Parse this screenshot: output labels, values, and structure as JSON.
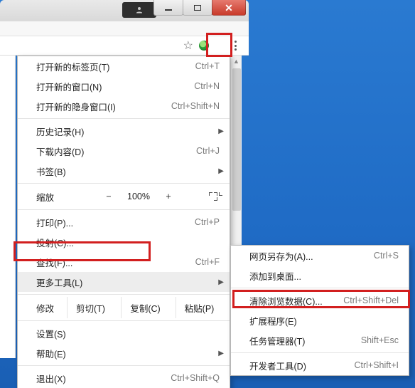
{
  "window": {
    "min": "",
    "max": "",
    "close": "✕"
  },
  "menu1": {
    "newtab": {
      "label": "打开新的标签页(T)",
      "shortcut": "Ctrl+T"
    },
    "newwin": {
      "label": "打开新的窗口(N)",
      "shortcut": "Ctrl+N"
    },
    "incognito": {
      "label": "打开新的隐身窗口(I)",
      "shortcut": "Ctrl+Shift+N"
    },
    "history": {
      "label": "历史记录(H)"
    },
    "downloads": {
      "label": "下载内容(D)",
      "shortcut": "Ctrl+J"
    },
    "bookmarks": {
      "label": "书签(B)"
    },
    "zoom": {
      "label": "缩放",
      "minus": "−",
      "pct": "100%",
      "plus": "+"
    },
    "print": {
      "label": "打印(P)...",
      "shortcut": "Ctrl+P"
    },
    "cast": {
      "label": "投射(C)..."
    },
    "find": {
      "label": "查找(F)...",
      "shortcut": "Ctrl+F"
    },
    "moretools": {
      "label": "更多工具(L)"
    },
    "edit": {
      "label": "修改",
      "cut": "剪切(T)",
      "copy": "复制(C)",
      "paste": "粘贴(P)"
    },
    "settings": {
      "label": "设置(S)"
    },
    "help": {
      "label": "帮助(E)"
    },
    "exit": {
      "label": "退出(X)",
      "shortcut": "Ctrl+Shift+Q"
    }
  },
  "menu2": {
    "saveas": {
      "label": "网页另存为(A)...",
      "shortcut": "Ctrl+S"
    },
    "addtodesktop": {
      "label": "添加到桌面..."
    },
    "cleardata": {
      "label": "清除浏览数据(C)...",
      "shortcut": "Ctrl+Shift+Del"
    },
    "extensions": {
      "label": "扩展程序(E)"
    },
    "taskmgr": {
      "label": "任务管理器(T)",
      "shortcut": "Shift+Esc"
    },
    "devtools": {
      "label": "开发者工具(D)",
      "shortcut": "Ctrl+Shift+I"
    }
  }
}
